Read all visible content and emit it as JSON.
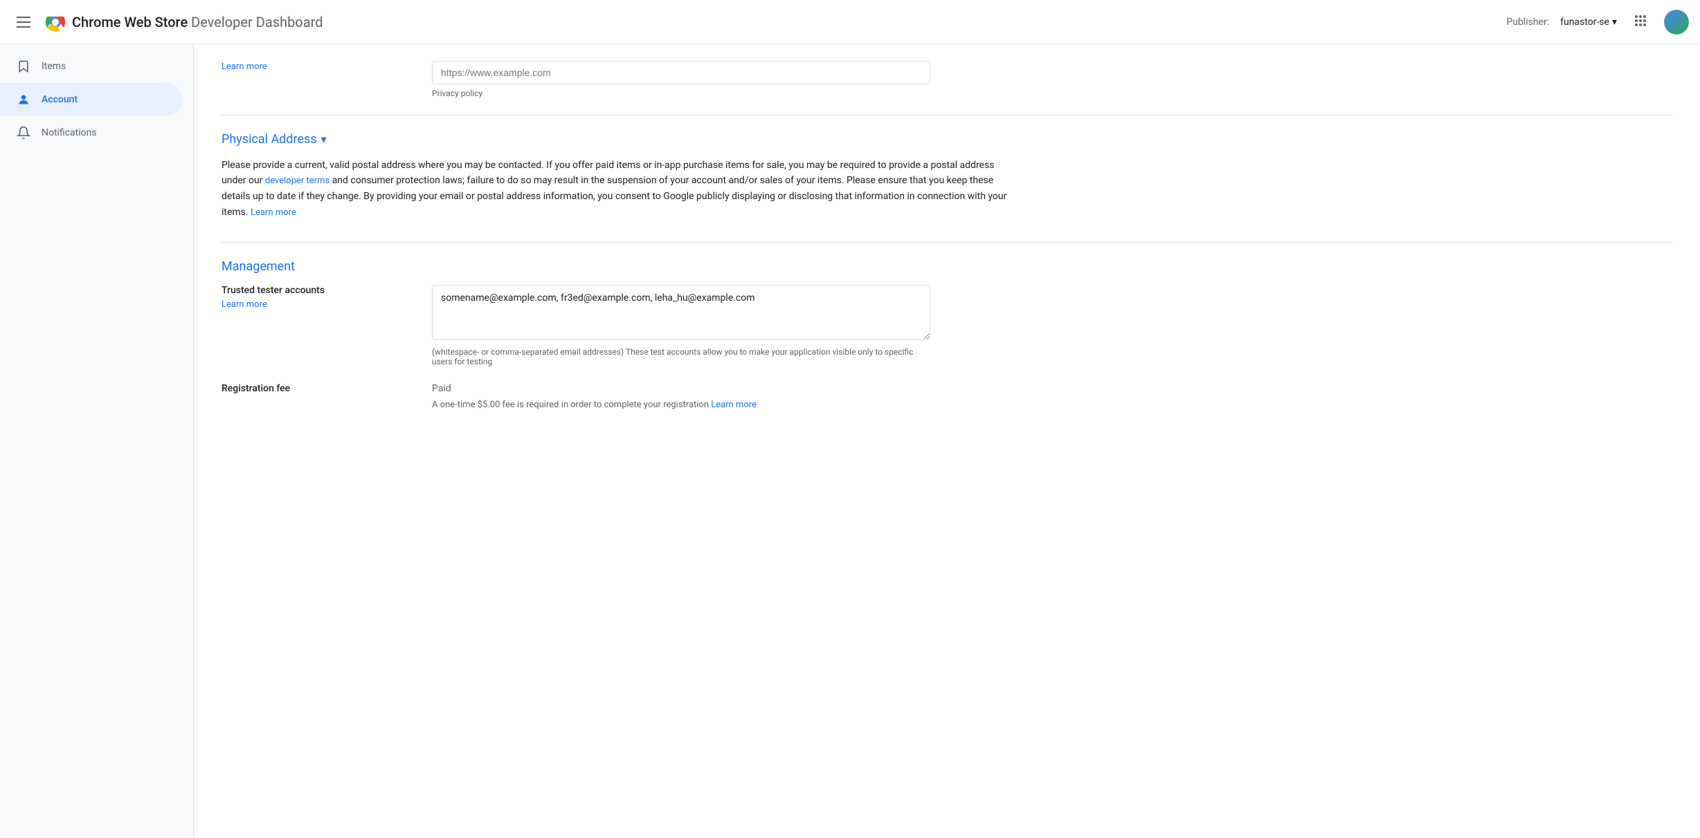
{
  "header": {
    "hamburger_label": "menu",
    "app_name": "Chrome Web Store",
    "app_subtitle": "Developer Dashboard",
    "publisher_label": "Publisher:",
    "publisher_name": "funastor-se",
    "grid_icon_label": "apps",
    "avatar_label": "user avatar"
  },
  "sidebar": {
    "items": [
      {
        "id": "items",
        "label": "Items",
        "icon": "bookmark-icon",
        "active": false
      },
      {
        "id": "account",
        "label": "Account",
        "icon": "account-icon",
        "active": true
      },
      {
        "id": "notifications",
        "label": "Notifications",
        "icon": "bell-icon",
        "active": false
      }
    ]
  },
  "main": {
    "privacy_policy": {
      "label": "Privacy policy",
      "learn_more_label": "Learn more",
      "placeholder": "https://www.example.com"
    },
    "physical_address": {
      "section_title": "Physical Address",
      "description_part1": "Please provide a current, valid postal address where you may be contacted. If you offer paid items or in-app purchase items for sale, you may be required to provide a postal address under our ",
      "developer_terms_link": "developer terms",
      "description_part2": " and consumer protection laws; failure to do so may result in the suspension of your account and/or sales of your items. Please ensure that you keep these details up to date if they change. By providing your email or postal address information, you consent to Google publicly displaying or disclosing that information in connection with your items. ",
      "learn_more_link": "Learn more"
    },
    "management": {
      "section_title": "Management",
      "trusted_tester": {
        "label": "Trusted tester accounts",
        "learn_more_label": "Learn more",
        "value": "somename@example.com, fr3ed@example.com, leha_hu@example.com",
        "hint": "(whitespace- or comma-separated email addresses) These test accounts allow you to make your application visible only to specific users for testing"
      },
      "registration_fee": {
        "label": "Registration fee",
        "value": "Paid",
        "description_part1": "A one-time $5.00 fee is required in order to complete your registration ",
        "learn_more_link": "Learn more"
      }
    }
  }
}
